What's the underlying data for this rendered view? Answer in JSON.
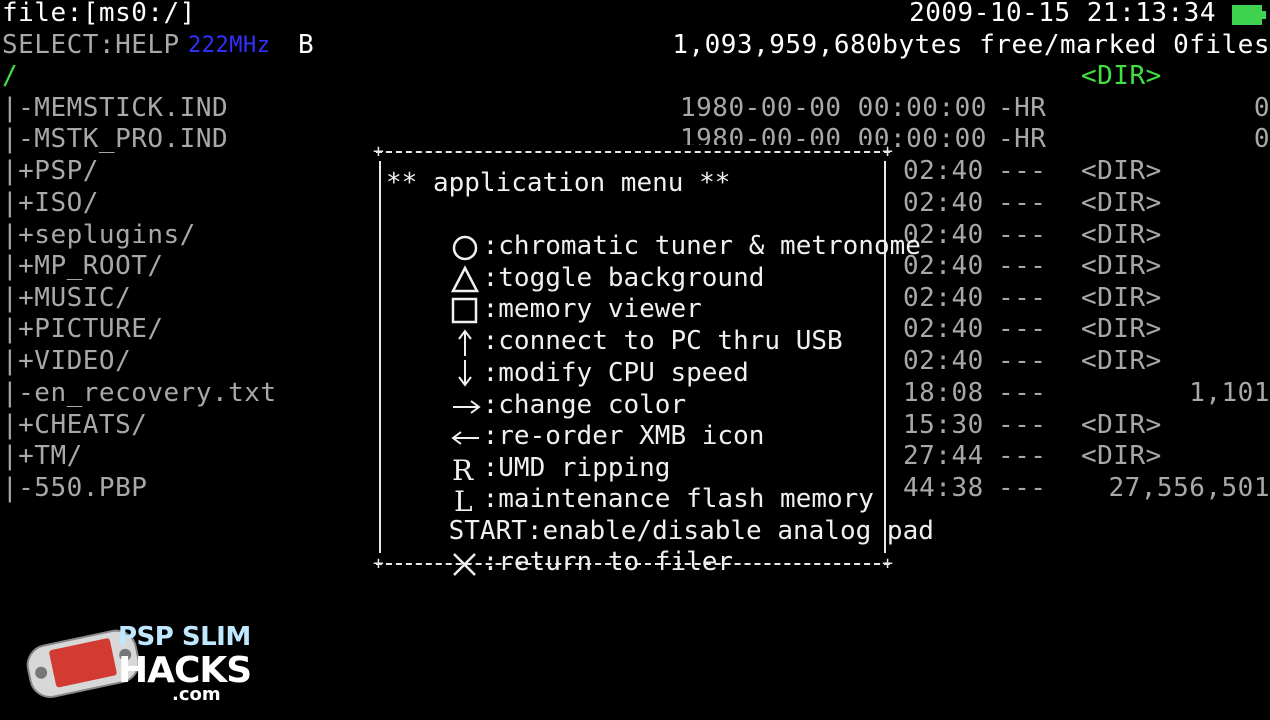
{
  "header": {
    "path": "file:[ms0:/]",
    "datetime": "2009-10-15 21:13:34",
    "select_help": "SELECT:HELP",
    "cpu_speed": "222MHz",
    "drive": "B",
    "free_info": "1,093,959,680bytes free/marked 0files",
    "current_dir": "/",
    "current_dir_tag": "<DIR>"
  },
  "files": [
    {
      "name": "|-MEMSTICK.IND",
      "date": "1980-00-00 00:00:00",
      "attr": "-HR",
      "size": "0"
    },
    {
      "name": "|-MSTK_PRO.IND",
      "date": "1980-00-00 00:00:00",
      "attr": "-HR",
      "size": "0"
    },
    {
      "name": "|+PSP/",
      "time": "02:40",
      "attr": "---",
      "size": "<DIR>"
    },
    {
      "name": "|+ISO/",
      "time": "02:40",
      "attr": "---",
      "size": "<DIR>"
    },
    {
      "name": "|+seplugins/",
      "time": "02:40",
      "attr": "---",
      "size": "<DIR>"
    },
    {
      "name": "|+MP_ROOT/",
      "time": "02:40",
      "attr": "---",
      "size": "<DIR>"
    },
    {
      "name": "|+MUSIC/",
      "time": "02:40",
      "attr": "---",
      "size": "<DIR>"
    },
    {
      "name": "|+PICTURE/",
      "time": "02:40",
      "attr": "---",
      "size": "<DIR>"
    },
    {
      "name": "|+VIDEO/",
      "time": "02:40",
      "attr": "---",
      "size": "<DIR>"
    },
    {
      "name": "|-en_recovery.txt",
      "time": "18:08",
      "attr": "---",
      "size": "1,101"
    },
    {
      "name": "|+CHEATS/",
      "time": "15:30",
      "attr": "---",
      "size": "<DIR>"
    },
    {
      "name": "|+TM/",
      "time": "27:44",
      "attr": "---",
      "size": "<DIR>"
    },
    {
      "name": "|-550.PBP",
      "time": "44:38",
      "attr": "---",
      "size": "27,556,501"
    }
  ],
  "menu": {
    "title": "** application menu **",
    "items": [
      {
        "icon": "circle-icon",
        "label": ":chromatic tuner & metronome"
      },
      {
        "icon": "triangle-icon",
        "label": ":toggle background"
      },
      {
        "icon": "square-icon",
        "label": ":memory viewer"
      },
      {
        "icon": "dpad-up-icon",
        "label": ":connect to PC thru USB"
      },
      {
        "icon": "dpad-down-icon",
        "label": ":modify CPU speed"
      },
      {
        "icon": "dpad-right-icon",
        "label": ":change color"
      },
      {
        "icon": "dpad-left-icon",
        "label": ":re-order XMB icon"
      },
      {
        "icon": "r-button-icon",
        "label": ":UMD ripping"
      },
      {
        "icon": "l-button-icon",
        "label": ":maintenance flash memory"
      },
      {
        "icon": "start-button",
        "label": "START:enable/disable analog pad"
      },
      {
        "icon": "cross-icon",
        "label": ":return to filer"
      }
    ]
  },
  "logo": {
    "line1": "PSP SLIM",
    "line2": "HACKS",
    "line3": ".com"
  }
}
